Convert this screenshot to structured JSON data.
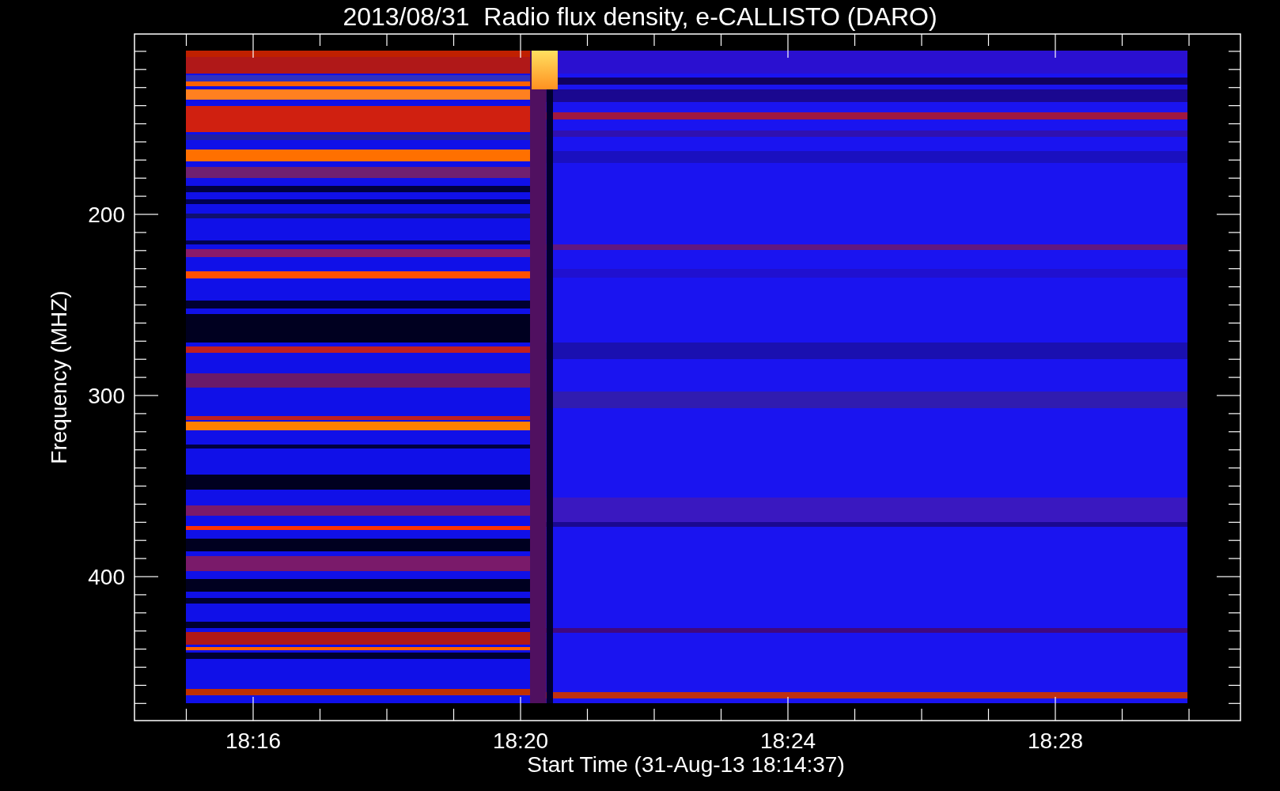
{
  "title": "2013/08/31  Radio flux density, e-CALLISTO (DARO)",
  "y_axis": {
    "label": "Frequency (MHZ)",
    "tick_labels": [
      "200",
      "300",
      "400"
    ]
  },
  "x_axis": {
    "label": "Start Time (31-Aug-13 18:14:37)",
    "tick_labels": [
      "18:16",
      "18:20",
      "18:24",
      "18:28"
    ]
  }
}
